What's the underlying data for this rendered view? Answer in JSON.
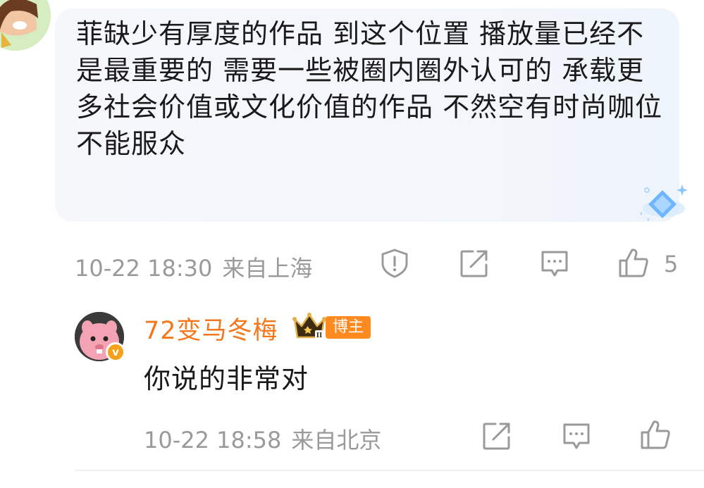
{
  "comment": {
    "text": "菲缺少有厚度的作品 到这个位置 播放量已经不是最重要的 需要一些被圈内圈外认可的 承载更多社会价值或文化价值的作品 不然空有时尚咖位不能服众",
    "date": "10-22 18:30",
    "location": "来自上海",
    "like_count": "5"
  },
  "reply": {
    "username": "72变马冬梅",
    "badge": "博主",
    "crown_level": "II",
    "avatar_badge": "v",
    "text": "你说的非常对",
    "date": "10-22 18:58",
    "location": "来自北京"
  },
  "colors": {
    "username": "#f5771c",
    "meta": "#9a9a9a",
    "bubble": "#f5f7fb"
  }
}
